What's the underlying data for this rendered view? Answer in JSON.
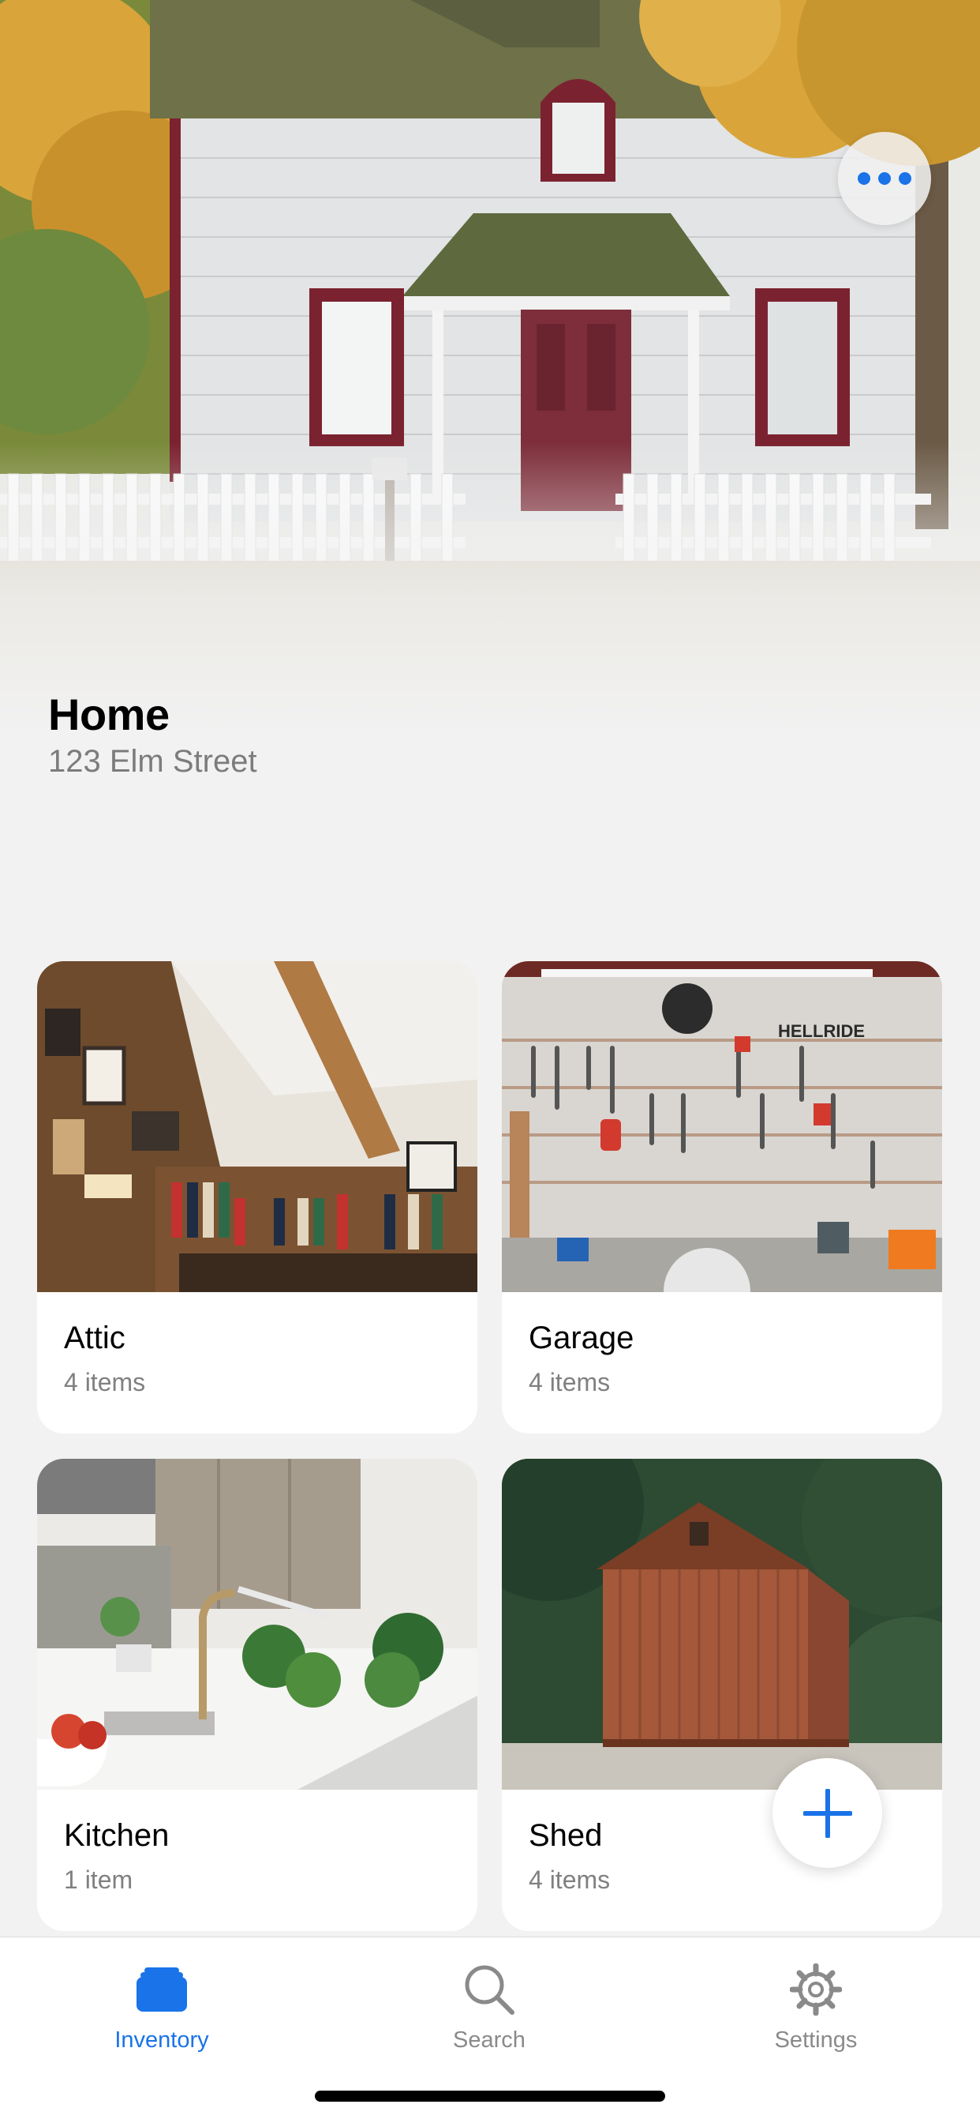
{
  "header": {
    "title": "Home",
    "address": "123 Elm Street",
    "more_icon": "ellipsis-icon"
  },
  "locations": [
    {
      "name": "Attic",
      "count": "4 items"
    },
    {
      "name": "Garage",
      "count": "4 items",
      "sign_text": "HELLRIDE"
    },
    {
      "name": "Kitchen",
      "count": "1 item"
    },
    {
      "name": "Shed",
      "count": "4 items"
    }
  ],
  "fab": {
    "icon": "plus-icon"
  },
  "tabbar": {
    "tabs": [
      {
        "label": "Inventory",
        "icon": "inventory-icon",
        "active": true
      },
      {
        "label": "Search",
        "icon": "search-icon",
        "active": false
      },
      {
        "label": "Settings",
        "icon": "gear-icon",
        "active": false
      }
    ]
  },
  "colors": {
    "accent": "#1a73e8",
    "background": "#f2f2f2",
    "secondary_text": "#7c7c7c"
  }
}
